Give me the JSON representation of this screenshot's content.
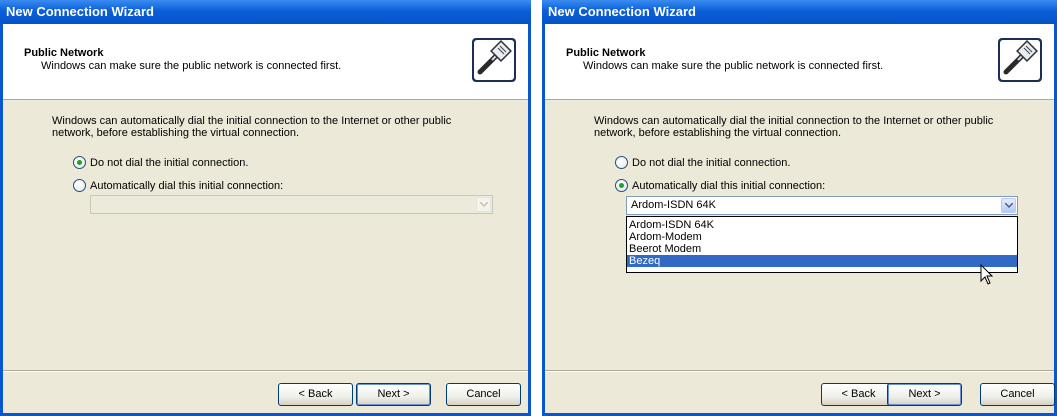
{
  "window_title": "New Connection Wizard",
  "header": {
    "title": "Public Network",
    "subtitle": "Windows can make sure the public network is connected first."
  },
  "description": "Windows can automatically dial the initial connection to the Internet or other public network, before establishing the virtual connection.",
  "options": {
    "no_dial": "Do not dial the initial connection.",
    "auto_dial": "Automatically dial this initial connection:"
  },
  "left_dialog": {
    "selected_option": "no_dial",
    "combo_value": "",
    "combo_enabled": false
  },
  "right_dialog": {
    "selected_option": "auto_dial",
    "combo_value": "Ardom-ISDN 64K",
    "combo_enabled": true,
    "dropdown_items": [
      "Ardom-ISDN 64K",
      "Ardom-Modem",
      "Beerot Modem",
      "Bezeq"
    ],
    "highlighted_item": "Bezeq"
  },
  "buttons": {
    "back": "< Back",
    "next": "Next >",
    "cancel": "Cancel"
  },
  "colors": {
    "titlebar": "#0a5fd8",
    "dialog_bg": "#ece9d8",
    "selection": "#316ac5"
  }
}
